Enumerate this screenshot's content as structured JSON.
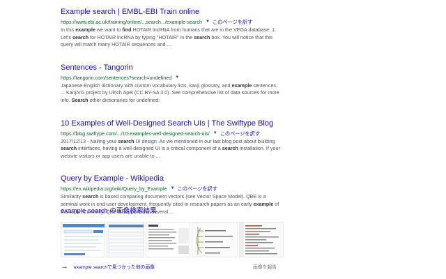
{
  "results": [
    {
      "title": "Example search | EMBL-EBI Train online",
      "url": "https://www.ebi.ac.uk/training/online/...search.../example-search",
      "translate": "このページを訳す",
      "snippet": [
        "In this ",
        {
          "b": "example"
        },
        " we want to ",
        {
          "b": "find"
        },
        " HOTAIR lncRNA from humans that are in the VEGA database: 1. Let's ",
        {
          "b": "search"
        },
        " for HOTAIR lncRNA by typing \"HOTAIR\" in the ",
        {
          "b": "search"
        },
        " box. You will notice that this query will match many HOTAIR sequences and ..."
      ]
    },
    {
      "title": "Sentences - Tangorin",
      "url": "https://tangorin.com/sentences?search=undefined",
      "translate": "",
      "snippet": [
        "Japanese English dictionary with custom vocabulary lists, kanji glossary, and ",
        {
          "b": "example"
        },
        " sentences. ... KanjiVG project by Ulrich Apel (CC BY-SA 3.0). See comprehensive list of data sources for more info. ",
        {
          "b": "Search"
        },
        " other dictionaries for undefined:"
      ]
    },
    {
      "title": "10 Examples of Well-Designed Search UIs | The Swiftype Blog",
      "url": "https://blog.swiftype.com/.../10-examples-well-designed-search-uis/",
      "translate": "このページを訳す",
      "snippet": [
        "2017/12/13 - Nailing your ",
        {
          "b": "search"
        },
        " UI design. As we mentioned in our last blog post about building ",
        {
          "b": "search"
        },
        " interfaces, having a well-designed UI is a critical component of a ",
        {
          "b": "search"
        },
        " installation. If your website visitors or app users are unable to ..."
      ]
    },
    {
      "title": "Query by Example - Wikipedia",
      "url": "https://en.wikipedia.org/wiki/Query_by_Example",
      "translate": "このページを訳す",
      "snippet": [
        "Similarity ",
        {
          "b": "search"
        },
        " is based comparing document vectors (see Vector Space Model). QBE is a seminal work in end-user development, frequently cited in research papers as an early ",
        {
          "b": "example"
        },
        " of this topic. Currently, QBE is supported in several ..."
      ]
    }
  ],
  "images": {
    "heading_query": "example search",
    "heading_suffix": " の画像検索結果",
    "more_label": "example searchで見つかった他の画像",
    "report_label": "画像を報告",
    "thumbnails": [
      {
        "name": "thumb-search-form",
        "bg": "#eaf1f8",
        "accent": "#4a8bc9"
      },
      {
        "name": "thumb-table-list",
        "bg": "#f5f7fa",
        "accent": "#5b7fb3"
      },
      {
        "name": "thumb-document",
        "bg": "#ffffff",
        "accent": "#777777"
      },
      {
        "name": "thumb-code-tree",
        "bg": "#fbfbfb",
        "accent": "#3a9a3a"
      },
      {
        "name": "thumb-code-editor",
        "bg": "#fafafa",
        "accent": "#c0392b"
      }
    ]
  }
}
